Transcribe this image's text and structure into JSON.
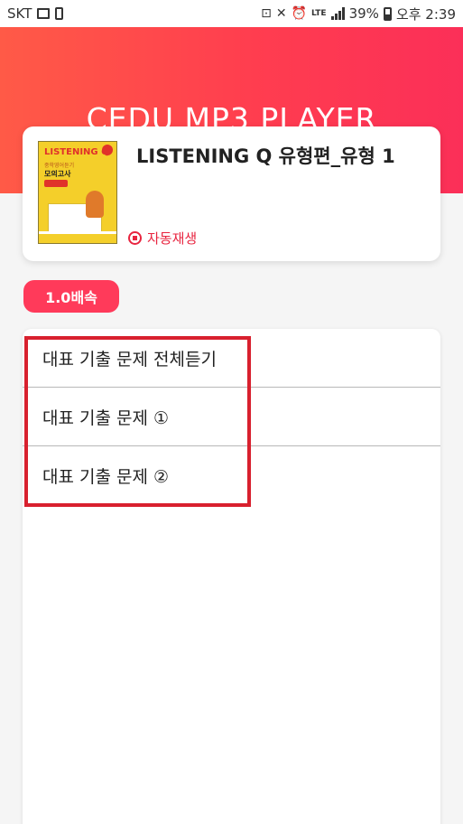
{
  "status_bar": {
    "carrier": "SKT",
    "lte": "LTE",
    "battery": "39%",
    "time": "오후 2:39"
  },
  "header": {
    "title": "CEDU MP3 PLAYER"
  },
  "album": {
    "title": "LISTENING Q 유형편_유형 1",
    "cover_heading": "LISTENING Q",
    "cover_subtitle": "중학영어듣기",
    "cover_main": "모의고사",
    "autoplay_label": "자동재생"
  },
  "speed": {
    "label": "1.0배속"
  },
  "tracks": [
    {
      "label": "대표 기출 문제 전체듣기"
    },
    {
      "label": "대표 기출 문제 ①"
    },
    {
      "label": "대표 기출 문제 ②"
    }
  ],
  "colors": {
    "accent": "#ff3a5a",
    "header_gradient_start": "#ff5a47",
    "header_gradient_end": "#fb2f58",
    "highlight": "#d8202e"
  }
}
